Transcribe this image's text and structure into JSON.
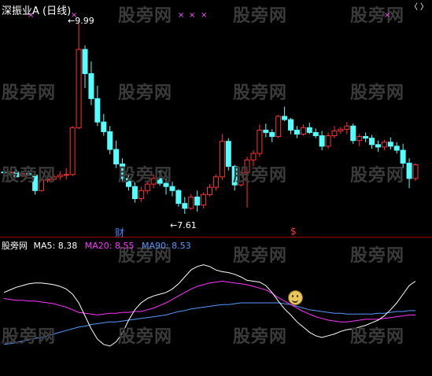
{
  "app": {
    "title": "深振业A (日线)",
    "watermark": "股旁网",
    "price_labels": {
      "high": "9.99",
      "low": "7.61"
    },
    "event_markers": [
      "财",
      "$"
    ],
    "top_marks": [
      "×",
      "×",
      "×",
      "×",
      "×",
      "×"
    ]
  },
  "indicator": {
    "source": "股旁网",
    "ma5_label": "MA5:",
    "ma5_value": "8.38",
    "ma20_label": "MA20:",
    "ma20_value": "8.55",
    "ma90_label": "MA90:",
    "ma90_value": "8.53",
    "colors": {
      "ma5": "#ffffff",
      "ma20": "#ff33ff",
      "ma90": "#5599ff"
    }
  },
  "chart_data": {
    "type": "candlestick",
    "price_high": 9.99,
    "price_low": 7.61,
    "candles": [
      [
        8.13,
        8.17,
        8.12,
        8.12
      ],
      [
        8.12,
        8.14,
        8.08,
        8.13
      ],
      [
        8.13,
        8.16,
        8.08,
        8.07
      ],
      [
        8.08,
        8.12,
        8.07,
        8.11
      ],
      [
        8.11,
        8.15,
        8.08,
        8.09
      ],
      [
        8.09,
        8.1,
        7.85,
        7.9
      ],
      [
        7.9,
        8.05,
        7.89,
        8.03
      ],
      [
        8.03,
        8.09,
        8.0,
        8.04
      ],
      [
        8.04,
        8.1,
        8.02,
        8.07
      ],
      [
        8.07,
        8.14,
        8.03,
        8.09
      ],
      [
        8.09,
        8.18,
        8.04,
        8.1
      ],
      [
        8.1,
        8.7,
        8.08,
        8.68
      ],
      [
        8.68,
        9.99,
        8.66,
        9.65
      ],
      [
        9.65,
        9.7,
        9.17,
        9.35
      ],
      [
        9.35,
        9.5,
        8.96,
        9.04
      ],
      [
        9.04,
        9.2,
        8.7,
        8.75
      ],
      [
        8.75,
        8.85,
        8.58,
        8.63
      ],
      [
        8.63,
        8.7,
        8.35,
        8.41
      ],
      [
        8.41,
        8.52,
        8.18,
        8.23
      ],
      [
        8.23,
        8.3,
        8.0,
        8.05
      ],
      [
        8.05,
        8.1,
        7.9,
        7.95
      ],
      [
        7.95,
        8.0,
        7.75,
        7.8
      ],
      [
        7.8,
        7.95,
        7.76,
        7.9
      ],
      [
        7.9,
        8.02,
        7.86,
        7.98
      ],
      [
        7.98,
        8.1,
        7.93,
        8.05
      ],
      [
        8.05,
        8.15,
        7.96,
        7.99
      ],
      [
        7.99,
        8.05,
        7.85,
        7.95
      ],
      [
        7.95,
        8.01,
        7.83,
        7.9
      ],
      [
        7.9,
        7.92,
        7.7,
        7.74
      ],
      [
        7.74,
        7.82,
        7.61,
        7.68
      ],
      [
        7.68,
        7.86,
        7.66,
        7.82
      ],
      [
        7.82,
        7.9,
        7.64,
        7.72
      ],
      [
        7.72,
        7.88,
        7.68,
        7.85
      ],
      [
        7.85,
        7.98,
        7.83,
        7.94
      ],
      [
        7.94,
        8.1,
        7.9,
        8.07
      ],
      [
        8.07,
        8.6,
        8.03,
        8.51
      ],
      [
        8.51,
        8.55,
        8.15,
        8.2
      ],
      [
        8.2,
        8.22,
        7.9,
        7.97
      ],
      [
        7.97,
        8.14,
        7.95,
        8.12
      ],
      [
        8.12,
        8.32,
        7.69,
        8.28
      ],
      [
        8.28,
        8.4,
        8.2,
        8.36
      ],
      [
        8.36,
        8.72,
        8.32,
        8.65
      ],
      [
        8.65,
        8.73,
        8.56,
        8.62
      ],
      [
        8.62,
        8.66,
        8.5,
        8.57
      ],
      [
        8.57,
        8.84,
        8.55,
        8.82
      ],
      [
        8.82,
        8.94,
        8.76,
        8.78
      ],
      [
        8.78,
        8.8,
        8.6,
        8.65
      ],
      [
        8.65,
        8.7,
        8.55,
        8.6
      ],
      [
        8.6,
        8.72,
        8.58,
        8.68
      ],
      [
        8.68,
        8.74,
        8.6,
        8.62
      ],
      [
        8.62,
        8.67,
        8.55,
        8.58
      ],
      [
        8.58,
        8.64,
        8.4,
        8.45
      ],
      [
        8.45,
        8.62,
        8.42,
        8.58
      ],
      [
        8.58,
        8.7,
        8.55,
        8.64
      ],
      [
        8.64,
        8.69,
        8.6,
        8.66
      ],
      [
        8.66,
        8.75,
        8.6,
        8.7
      ],
      [
        8.7,
        8.73,
        8.48,
        8.52
      ],
      [
        8.52,
        8.6,
        8.45,
        8.57
      ],
      [
        8.57,
        8.62,
        8.5,
        8.55
      ],
      [
        8.55,
        8.59,
        8.42,
        8.47
      ],
      [
        8.47,
        8.52,
        8.38,
        8.44
      ],
      [
        8.44,
        8.53,
        8.4,
        8.5
      ],
      [
        8.5,
        8.56,
        8.41,
        8.45
      ],
      [
        8.45,
        8.5,
        8.36,
        8.4
      ],
      [
        8.4,
        8.48,
        8.18,
        8.24
      ],
      [
        8.24,
        8.3,
        7.93,
        8.05
      ],
      [
        8.05,
        8.24,
        8.02,
        8.22
      ]
    ],
    "indicator_series": {
      "ma5": [
        0.62,
        0.65,
        0.68,
        0.7,
        0.72,
        0.73,
        0.73,
        0.72,
        0.71,
        0.69,
        0.66,
        0.6,
        0.5,
        0.35,
        0.2,
        0.08,
        0.02,
        0.0,
        0.05,
        0.15,
        0.3,
        0.42,
        0.5,
        0.55,
        0.58,
        0.6,
        0.62,
        0.66,
        0.72,
        0.8,
        0.88,
        0.92,
        0.94,
        0.92,
        0.88,
        0.86,
        0.85,
        0.83,
        0.8,
        0.76,
        0.75,
        0.74,
        0.7,
        0.62,
        0.52,
        0.43,
        0.36,
        0.28,
        0.22,
        0.16,
        0.12,
        0.1,
        0.12,
        0.14,
        0.17,
        0.19,
        0.2,
        0.22,
        0.24,
        0.27,
        0.3,
        0.35,
        0.42,
        0.5,
        0.6,
        0.7,
        0.75
      ],
      "ma20": [
        0.55,
        0.54,
        0.53,
        0.53,
        0.52,
        0.52,
        0.51,
        0.5,
        0.49,
        0.47,
        0.45,
        0.42,
        0.39,
        0.38,
        0.37,
        0.36,
        0.37,
        0.38,
        0.38,
        0.39,
        0.39,
        0.4,
        0.4,
        0.42,
        0.44,
        0.47,
        0.5,
        0.54,
        0.58,
        0.62,
        0.66,
        0.69,
        0.71,
        0.73,
        0.74,
        0.75,
        0.74,
        0.73,
        0.72,
        0.71,
        0.69,
        0.67,
        0.65,
        0.61,
        0.56,
        0.52,
        0.48,
        0.44,
        0.4,
        0.37,
        0.34,
        0.32,
        0.3,
        0.29,
        0.28,
        0.28,
        0.29,
        0.3,
        0.31,
        0.31,
        0.31,
        0.32,
        0.33,
        0.34,
        0.35,
        0.36,
        0.36
      ],
      "ma90": [
        0.02,
        0.03,
        0.04,
        0.06,
        0.07,
        0.09,
        0.1,
        0.12,
        0.14,
        0.16,
        0.18,
        0.2,
        0.22,
        0.23,
        0.25,
        0.26,
        0.27,
        0.28,
        0.28,
        0.29,
        0.3,
        0.31,
        0.32,
        0.33,
        0.34,
        0.35,
        0.36,
        0.38,
        0.4,
        0.41,
        0.43,
        0.44,
        0.45,
        0.46,
        0.47,
        0.48,
        0.48,
        0.49,
        0.5,
        0.5,
        0.5,
        0.5,
        0.5,
        0.5,
        0.5,
        0.49,
        0.48,
        0.46,
        0.44,
        0.42,
        0.41,
        0.4,
        0.39,
        0.38,
        0.38,
        0.37,
        0.37,
        0.37,
        0.37,
        0.37,
        0.38,
        0.38,
        0.39,
        0.4,
        0.4,
        0.41,
        0.41
      ]
    }
  }
}
